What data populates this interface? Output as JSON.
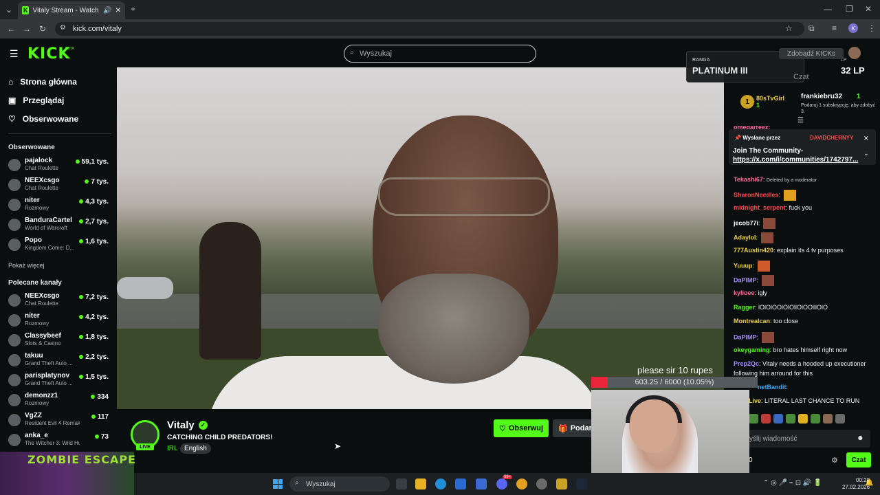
{
  "browser": {
    "tab_title": "Vitaly Stream - Watch Live o",
    "url": "kick.com/vitaly",
    "profile_initial": "K"
  },
  "header": {
    "logo": "KICK",
    "beta": "BETA",
    "search_placeholder": "Wyszukaj"
  },
  "sidebar": {
    "nav": [
      {
        "label": "Strona główna",
        "icon": "home-icon"
      },
      {
        "label": "Przeglądaj",
        "icon": "browse-icon"
      },
      {
        "label": "Obserwowane",
        "icon": "heart-icon"
      }
    ],
    "followed_title": "Obserwowane",
    "followed": [
      {
        "name": "pajalock",
        "category": "Chat Roulette",
        "viewers": "59,1 tys."
      },
      {
        "name": "NEEXcsgo",
        "category": "Chat Roulette",
        "viewers": "7 tys."
      },
      {
        "name": "niter",
        "category": "Rozmowy",
        "viewers": "4,3 tys."
      },
      {
        "name": "BanduraCartel",
        "category": "World of Warcraft",
        "viewers": "2,7 tys."
      },
      {
        "name": "Popo",
        "category": "Kingdom Come: D...",
        "viewers": "1,6 tys."
      }
    ],
    "show_more": "Pokaż więcej",
    "recommended_title": "Polecane kanały",
    "recommended": [
      {
        "name": "NEEXcsgo",
        "category": "Chat Roulette",
        "viewers": "7,2 tys."
      },
      {
        "name": "niter",
        "category": "Rozmowy",
        "viewers": "4,2 tys."
      },
      {
        "name": "Classybeef",
        "category": "Slots & Casino",
        "viewers": "1,8 tys."
      },
      {
        "name": "takuu",
        "category": "Grand Theft Auto ...",
        "viewers": "2,2 tys."
      },
      {
        "name": "parisplatynov",
        "category": "Grand Theft Auto ...",
        "viewers": "1,5 tys."
      },
      {
        "name": "demonzz1",
        "category": "Rozmowy",
        "viewers": "334"
      },
      {
        "name": "VgZZ",
        "category": "Resident Evil 4 Remake",
        "viewers": "117"
      },
      {
        "name": "anka_e",
        "category": "The Witcher 3: Wild Hunt",
        "viewers": "73"
      }
    ]
  },
  "stream": {
    "streamer": "Vitaly",
    "title": "CATCHING CHILD PREDATORS!",
    "category": "IRL",
    "language": "English",
    "live_badge": "LIVE",
    "follow_label": "Obserwuj",
    "gift_label": "Podaru"
  },
  "overlay": {
    "donate_text": "please sir 10 rupes",
    "donate_progress": "603.25 / 6000 (10.05%)",
    "donate_fraction": 0.1005,
    "zombie_title": "ZOMBIE ESCAPE"
  },
  "chat": {
    "claim_label": "Zdobądź KICKs",
    "rank_label": "RANGA",
    "rank_value": "PLATINUM III",
    "lp_label": "LP",
    "lp_value": "32 LP",
    "chat_label": "Czat",
    "top_gifter_rank": "1",
    "top_gifter": "80sTvGirl",
    "top_gifter_count": "1",
    "gifter2": "frankiebru32",
    "gifter2_count": "1",
    "gifter2_text": "Podaruj 1 subskrypcję, aby zdobyć 3.",
    "partial_user": "omegarreez:",
    "pinned_by": "Wysłane przez",
    "pinned_user": "DAVIDCHERNYY",
    "pinned_text": "Join The Community-",
    "pinned_link": "https://x.com/i/communities/1742797...",
    "messages": [
      {
        "user": "Tekashi67",
        "color": "#ff6b9a",
        "text": "Deleted by a moderator"
      },
      {
        "user": "SharonNeedles",
        "color": "#ff4d4d",
        "text": ""
      },
      {
        "user": "midnight_serpent",
        "color": "#ff4d4d",
        "text": "fuck you"
      },
      {
        "user": "jecob77i",
        "color": "#ffffff",
        "text": ""
      },
      {
        "user": "Adaylol",
        "color": "#f0d24a",
        "text": ""
      },
      {
        "user": "777Austin420",
        "color": "#f0d24a",
        "text": "explain its 4 tv purposes"
      },
      {
        "user": "Yuuup",
        "color": "#f0d24a",
        "text": ""
      },
      {
        "user": "DaPIMP",
        "color": "#a58bff",
        "text": ""
      },
      {
        "user": "kylioee",
        "color": "#ff6b9a",
        "text": "igly"
      },
      {
        "user": "Ragger",
        "color": "#53fc18",
        "text": "lOlOlOOlOlOllOlOOlllOlO"
      },
      {
        "user": "Montrealcan",
        "color": "#f0d24a",
        "text": "too close"
      },
      {
        "user": "DaPIMP",
        "color": "#a58bff",
        "text": ""
      },
      {
        "user": "okeygaming",
        "color": "#53fc18",
        "text": "bro hates himself right now"
      },
      {
        "user": "Prep2Qc",
        "color": "#a58bff",
        "text": "Vitaly needs a hooded up executioner"
      },
      {
        "user": "",
        "color": "#ffffff",
        "text": "following him arround for this"
      },
      {
        "user": "netBandit",
        "color": "#3ea6f0",
        "text": ""
      },
      {
        "user": "Live",
        "color": "#f0d24a",
        "text": "LITERAL LAST CHANCE TO RUN"
      }
    ],
    "input_placeholder": "yślij wiadomość",
    "send_label": "Czat",
    "counter": "0"
  },
  "taskbar": {
    "search_placeholder": "Wyszukaj",
    "time": "00:20",
    "date": "27.02.2026",
    "badge": "99+"
  }
}
